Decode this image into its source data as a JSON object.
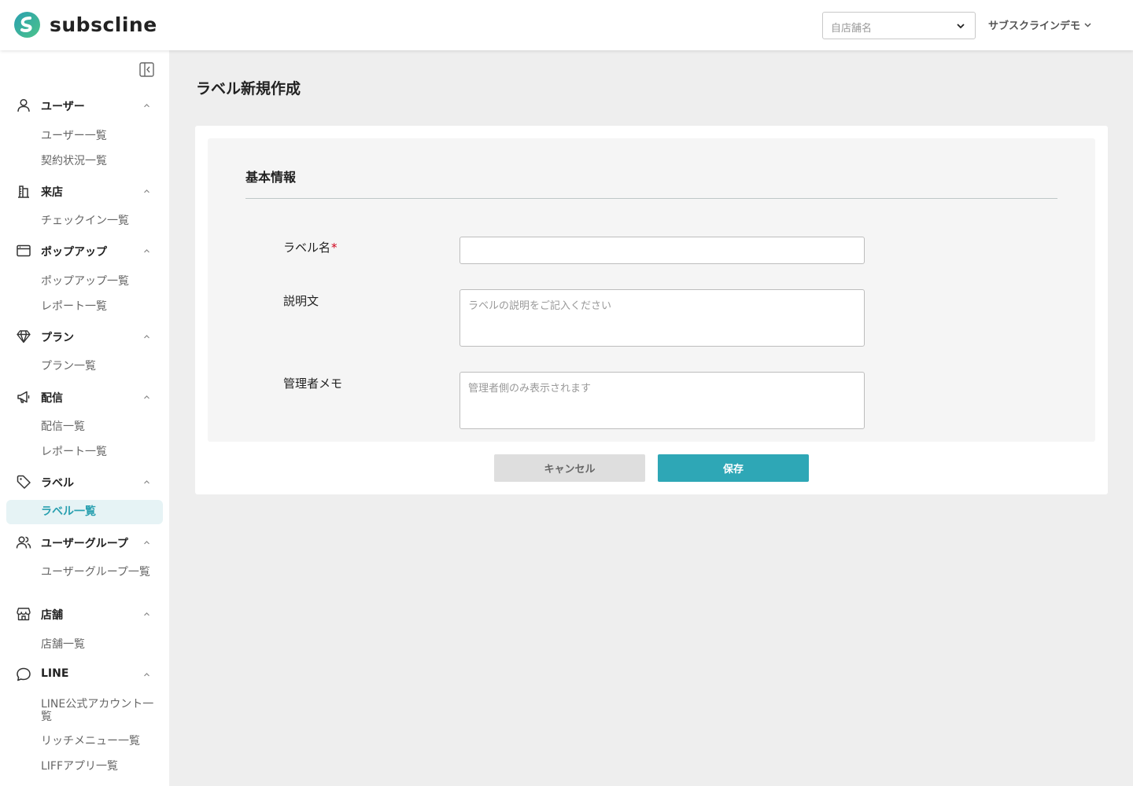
{
  "header": {
    "brand": "subscline",
    "store_select_placeholder": "自店舗名",
    "account_name": "サブスクラインデモ"
  },
  "sidebar": {
    "sections": [
      {
        "key": "user",
        "label": "ユーザー",
        "icon": "user-icon",
        "items": [
          "ユーザー一覧",
          "契約状況一覧"
        ]
      },
      {
        "key": "visit",
        "label": "来店",
        "icon": "building-icon",
        "items": [
          "チェックイン一覧"
        ]
      },
      {
        "key": "popup",
        "label": "ポップアップ",
        "icon": "window-icon",
        "items": [
          "ポップアップ一覧",
          "レポート一覧"
        ]
      },
      {
        "key": "plan",
        "label": "プラン",
        "icon": "diamond-icon",
        "items": [
          "プラン一覧"
        ]
      },
      {
        "key": "delivery",
        "label": "配信",
        "icon": "megaphone-icon",
        "items": [
          "配信一覧",
          "レポート一覧"
        ]
      },
      {
        "key": "label",
        "label": "ラベル",
        "icon": "tag-icon",
        "items": [
          "ラベル一覧"
        ]
      },
      {
        "key": "usergroup",
        "label": "ユーザーグループ",
        "icon": "users-icon",
        "items": [
          "ユーザーグループ一覧"
        ]
      },
      {
        "key": "store",
        "label": "店舗",
        "icon": "store-icon",
        "items": [
          "店舗一覧"
        ]
      },
      {
        "key": "line",
        "label": "LINE",
        "icon": "chat-bubble-icon",
        "items": [
          "LINE公式アカウント一覧",
          "リッチメニュー一覧",
          "LIFFアプリ一覧"
        ]
      }
    ],
    "active_item": "ラベル一覧"
  },
  "main": {
    "page_title": "ラベル新規作成",
    "section_title": "基本情報",
    "fields": {
      "label_name": {
        "label": "ラベル名",
        "required_mark": "*",
        "value": ""
      },
      "description": {
        "label": "説明文",
        "placeholder": "ラベルの説明をご記入ください",
        "value": ""
      },
      "admin_memo": {
        "label": "管理者メモ",
        "placeholder": "管理者側のみ表示されます",
        "value": ""
      }
    },
    "buttons": {
      "cancel": "キャンセル",
      "save": "保存"
    }
  },
  "colors": {
    "accent": "#2ea7b6",
    "active_bg": "#e6f3f5",
    "required": "#d0021b"
  }
}
